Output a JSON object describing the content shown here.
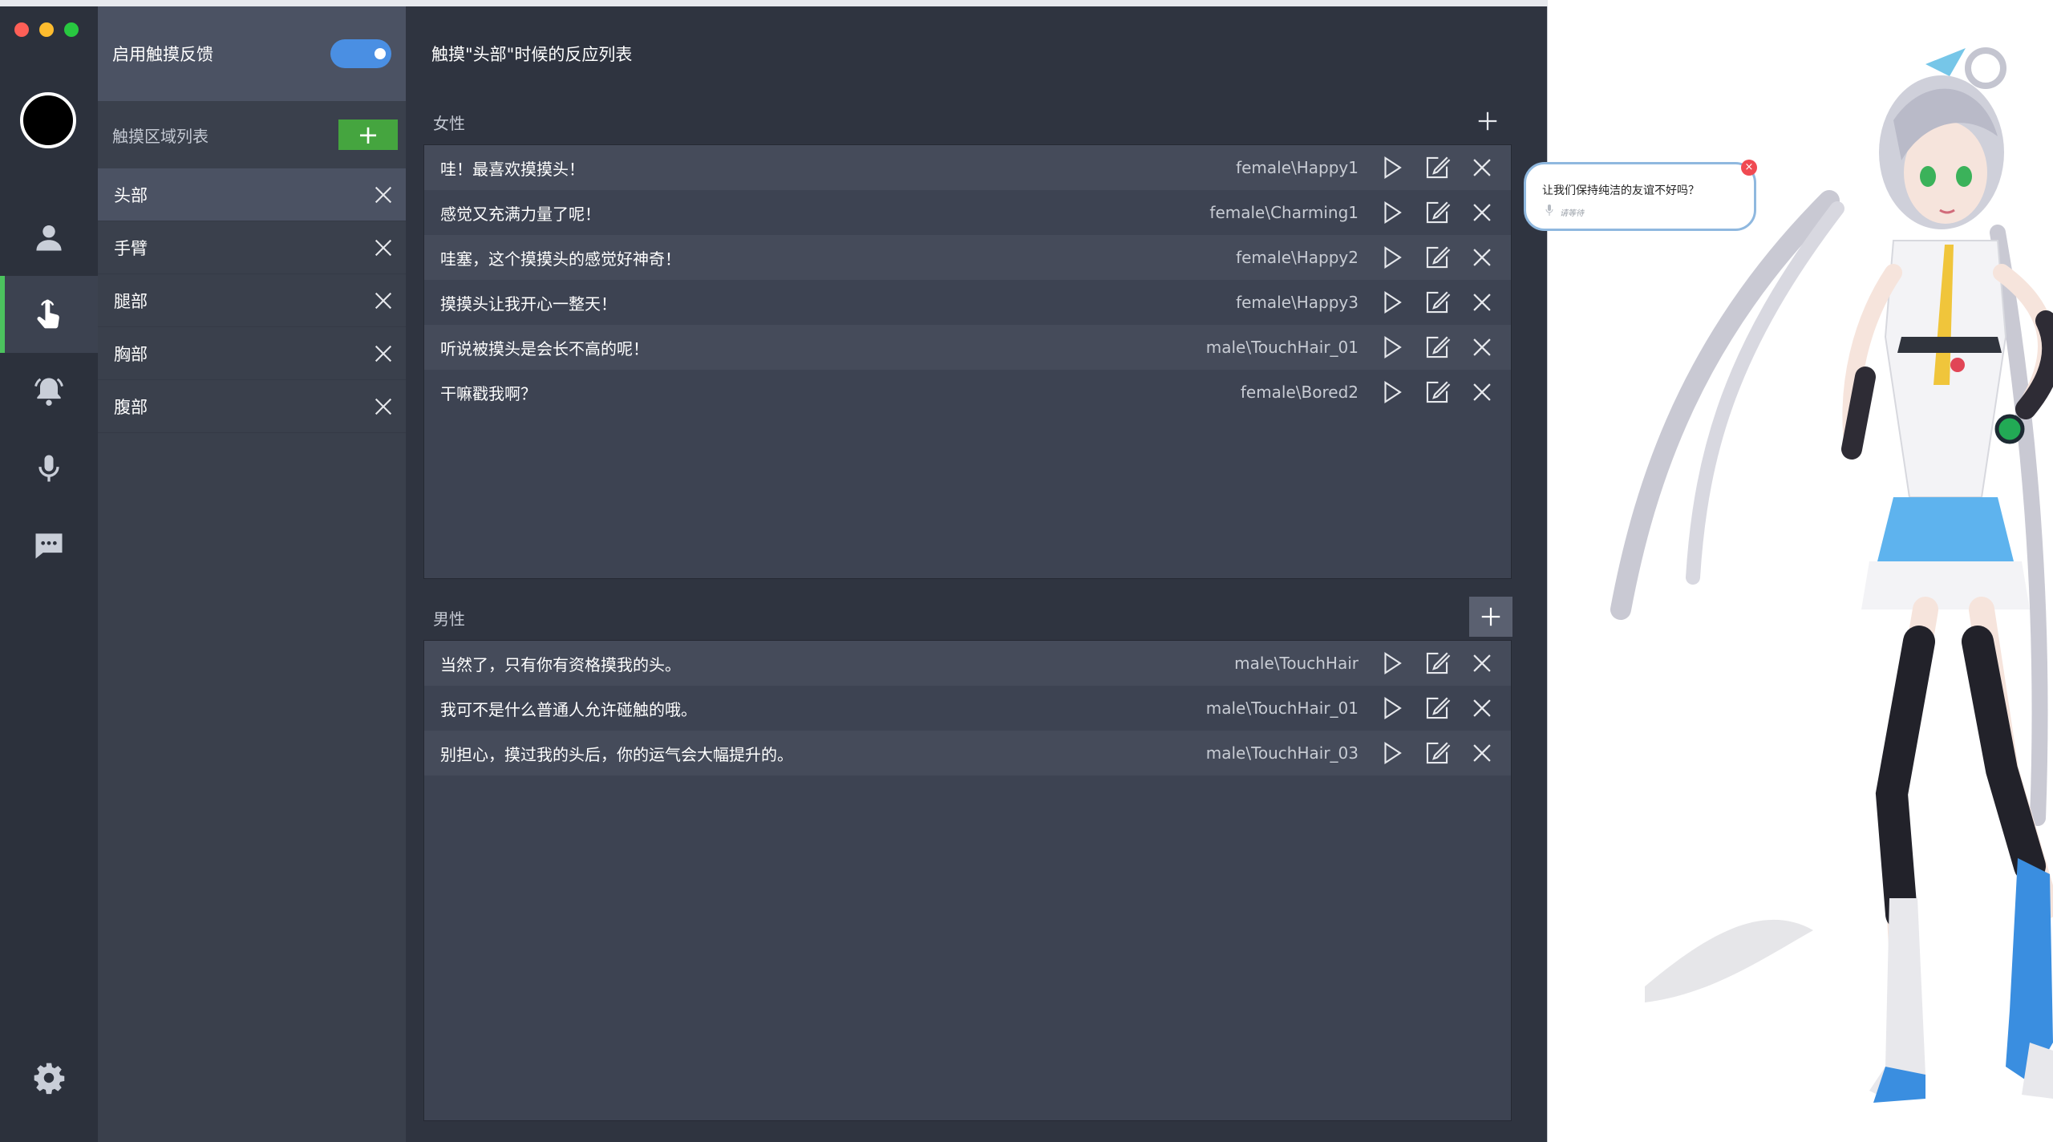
{
  "sidebar": {
    "items": [
      {
        "icon": "person-icon"
      },
      {
        "icon": "touch-hand-icon",
        "active": true
      },
      {
        "icon": "bell-icon"
      },
      {
        "icon": "microphone-icon"
      },
      {
        "icon": "chat-icon"
      }
    ],
    "settings_icon": "gear-icon"
  },
  "regions": {
    "toggle_label": "启用触摸反馈",
    "toggle_on": true,
    "header_label": "触摸区域列表",
    "add_label": "+",
    "items": [
      {
        "name": "头部",
        "selected": true
      },
      {
        "name": "手臂"
      },
      {
        "name": "腿部"
      },
      {
        "name": "胸部"
      },
      {
        "name": "腹部"
      }
    ]
  },
  "main": {
    "title": "触摸\"头部\"时候的反应列表",
    "female": {
      "label": "女性",
      "rows": [
        {
          "text": "哇！最喜欢摸摸头！",
          "anim": "female\\Happy1"
        },
        {
          "text": "感觉又充满力量了呢！",
          "anim": "female\\Charming1"
        },
        {
          "text": "哇塞，这个摸摸头的感觉好神奇！",
          "anim": "female\\Happy2"
        },
        {
          "text": "摸摸头让我开心一整天！",
          "anim": "female\\Happy3"
        },
        {
          "text": "听说被摸头是会长不高的呢！",
          "anim": "male\\TouchHair_01"
        },
        {
          "text": "干嘛戳我啊？",
          "anim": "female\\Bored2"
        }
      ]
    },
    "male": {
      "label": "男性",
      "rows": [
        {
          "text": "当然了，只有你有资格摸我的头。",
          "anim": "male\\TouchHair"
        },
        {
          "text": "我可不是什么普通人允许碰触的哦。",
          "anim": "male\\TouchHair_01"
        },
        {
          "text": "别担心，摸过我的头后，你的运气会大幅提升的。",
          "anim": "male\\TouchHair_03"
        }
      ]
    }
  },
  "bubble": {
    "message": "让我们保持纯洁的友谊不好吗？",
    "sub": "请等待"
  },
  "colors": {
    "accent_green": "#4cc35e",
    "toggle_blue": "#4a8fe3",
    "panel_bg": "#2f3440",
    "close_red": "#f04a52"
  }
}
